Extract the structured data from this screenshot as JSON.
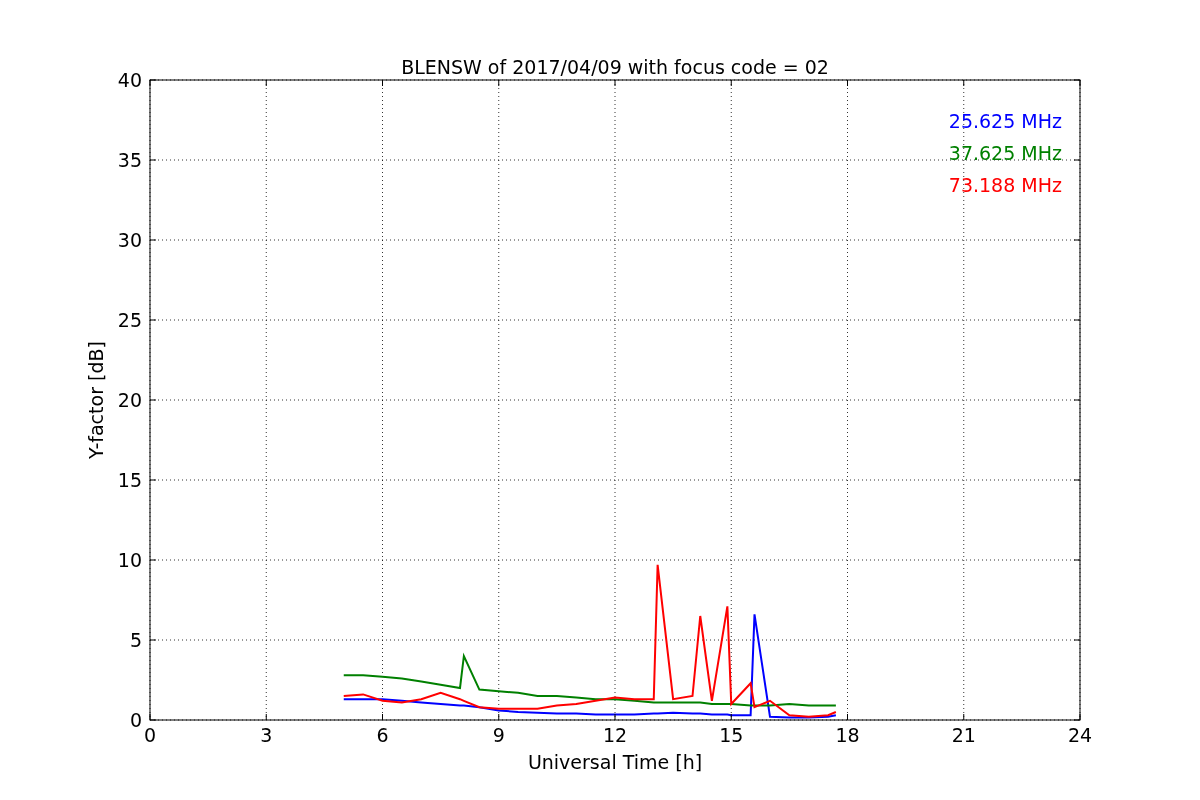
{
  "chart_data": {
    "type": "line",
    "title": "BLENSW of 2017/04/09 with focus code = 02",
    "xlabel": "Universal Time [h]",
    "ylabel": "Y-factor [dB]",
    "x": [
      5.0,
      5.5,
      6.0,
      6.5,
      7.0,
      7.5,
      8.0,
      8.1,
      8.5,
      9.0,
      9.5,
      10.0,
      10.5,
      11.0,
      11.5,
      12.0,
      12.5,
      13.0,
      13.1,
      13.5,
      14.0,
      14.2,
      14.5,
      14.9,
      15.0,
      15.5,
      15.6,
      16.0,
      16.5,
      17.0,
      17.5,
      17.7
    ],
    "series": [
      {
        "name": "25.625 MHz",
        "color": "#0000ff",
        "values": [
          1.3,
          1.3,
          1.3,
          1.2,
          1.1,
          1.0,
          0.9,
          0.9,
          0.8,
          0.6,
          0.5,
          0.45,
          0.4,
          0.4,
          0.35,
          0.35,
          0.35,
          0.4,
          0.4,
          0.45,
          0.4,
          0.4,
          0.35,
          0.35,
          0.3,
          0.3,
          6.6,
          0.2,
          0.15,
          0.15,
          0.2,
          0.3
        ]
      },
      {
        "name": "37.625 MHz",
        "color": "#008000",
        "values": [
          2.8,
          2.8,
          2.7,
          2.6,
          2.4,
          2.2,
          2.0,
          4.0,
          1.9,
          1.8,
          1.7,
          1.5,
          1.5,
          1.4,
          1.3,
          1.3,
          1.2,
          1.1,
          1.1,
          1.1,
          1.1,
          1.1,
          1.0,
          1.0,
          1.0,
          0.9,
          0.9,
          0.9,
          1.0,
          0.9,
          0.9,
          0.9
        ]
      },
      {
        "name": "73.188 MHz",
        "color": "#ff0000",
        "values": [
          1.5,
          1.6,
          1.2,
          1.1,
          1.3,
          1.7,
          1.3,
          1.2,
          0.8,
          0.7,
          0.7,
          0.7,
          0.9,
          1.0,
          1.2,
          1.4,
          1.3,
          1.3,
          9.7,
          1.3,
          1.5,
          6.5,
          1.2,
          7.1,
          1.0,
          2.3,
          0.8,
          1.2,
          0.3,
          0.2,
          0.3,
          0.5
        ]
      }
    ],
    "grid": true,
    "xlim": [
      0,
      24
    ],
    "ylim": [
      0,
      40
    ],
    "xticks": [
      0,
      3,
      6,
      9,
      12,
      15,
      18,
      21,
      24
    ],
    "yticks": [
      0,
      5,
      10,
      15,
      20,
      25,
      30,
      35,
      40
    ]
  }
}
